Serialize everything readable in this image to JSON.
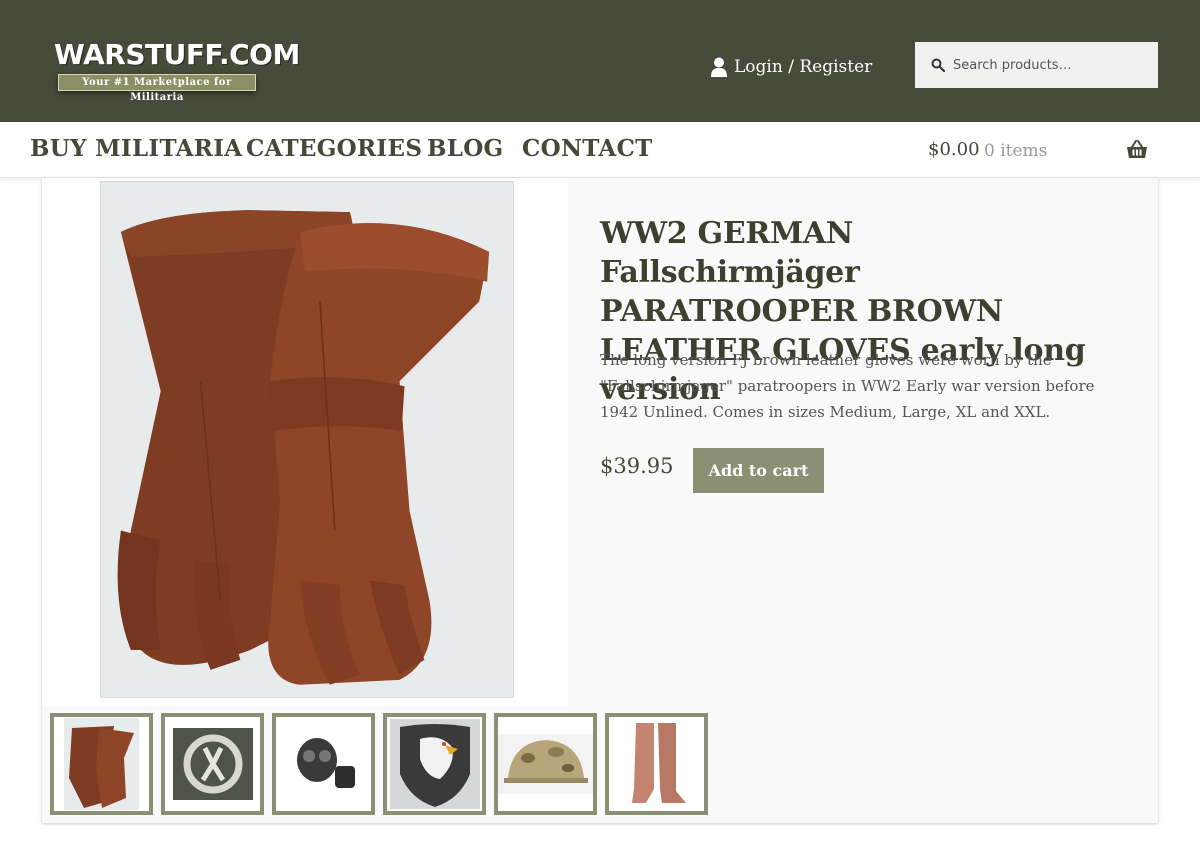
{
  "header": {
    "logo_title": "WARSTUFF.COM",
    "logo_tagline": "Your #1 Marketplace for Militaria",
    "login_label": "Login / Register",
    "search_placeholder": "Search products…"
  },
  "nav": {
    "items": [
      {
        "label": "BUY MILITARIA"
      },
      {
        "label": "CATEGORIES"
      },
      {
        "label": "BLOG"
      },
      {
        "label": "CONTACT"
      }
    ],
    "cart_total": "$0.00",
    "cart_count": "0 items"
  },
  "product": {
    "title": "WW2 GERMAN Fallschirmjäger PARATROOPER BROWN LEATHER GLOVES early long version",
    "description": "The long version FJ brown leather gloves were worn by the \"Fallschirmjager\" paratroopers in WW2 Early war version before 1942 Unlined. Comes in sizes Medium, Large,  XL and XXL.",
    "price": "$39.95",
    "add_to_cart_label": "Add to cart"
  },
  "icons": {
    "user": "user-icon",
    "search": "search-icon",
    "basket": "basket-icon"
  },
  "colors": {
    "header_bg": "#474b3a",
    "accent": "#8b8f73",
    "nav_text": "#444938"
  }
}
